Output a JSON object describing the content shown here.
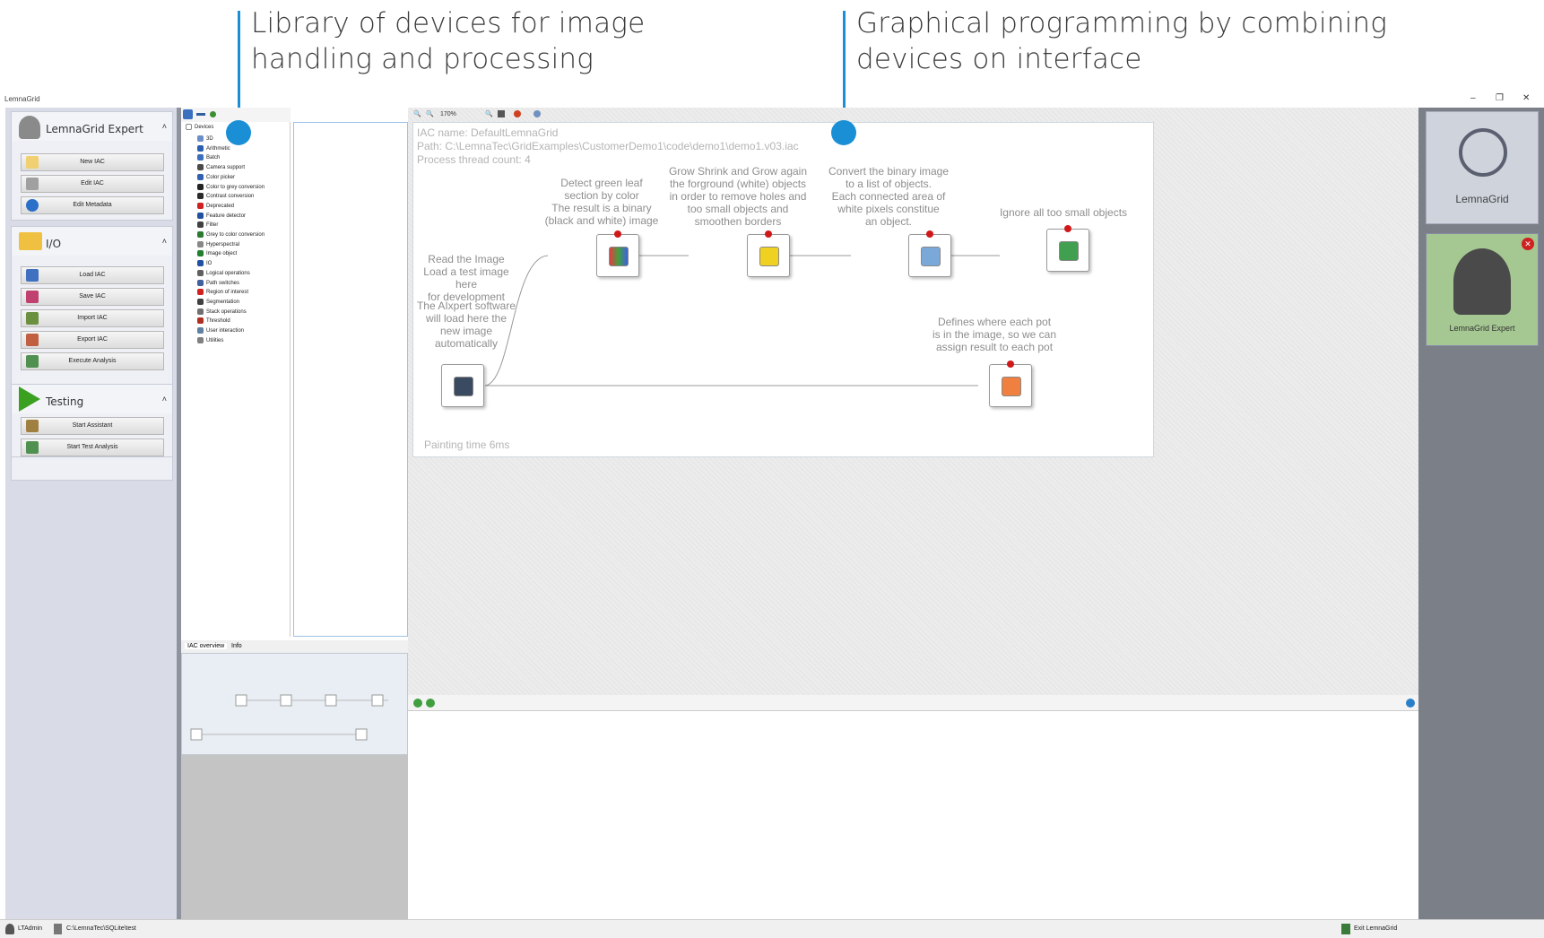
{
  "callouts": {
    "library_line1": "Library of devices for image",
    "library_line2": "handling and processing",
    "graphical_line1": "Graphical programming by combining",
    "graphical_line2": "devices on interface"
  },
  "window": {
    "title": "LemnaGrid",
    "minimize": "–",
    "restore": "❐",
    "close": "✕"
  },
  "left_panel": {
    "expert_group": {
      "title": "LemnaGrid Expert",
      "buttons": [
        "New IAC",
        "Edit IAC",
        "Edit Metadata"
      ]
    },
    "io_group": {
      "title": "I/O",
      "buttons": [
        "Load IAC",
        "Save IAC",
        "Import IAC",
        "Export IAC",
        "Execute Analysis"
      ]
    },
    "testing_group": {
      "title": "Testing",
      "buttons": [
        "Start Assistant",
        "Start Test Analysis"
      ]
    }
  },
  "tree": {
    "root": "Devices",
    "items": [
      "3D",
      "Arithmetic",
      "Batch",
      "Camera support",
      "Color picker",
      "Color to grey conversion",
      "Contrast conversion",
      "Deprecated",
      "Feature detector",
      "Filter",
      "Grey to color conversion",
      "Hyperspectral",
      "Image object",
      "IO",
      "Logical operations",
      "Path switches",
      "Region of interest",
      "Segmentation",
      "Stack operations",
      "Threshold",
      "User interaction",
      "Utilities"
    ],
    "item_colors": [
      "#6a8fc8",
      "#2a5fb0",
      "#3a6fc0",
      "#4a4a4a",
      "#3060b0",
      "#222222",
      "#2a2a2a",
      "#d02020",
      "#2050a0",
      "#404040",
      "#2a7a30",
      "#888888",
      "#208030",
      "#2050a0",
      "#606060",
      "#4060a0",
      "#d02020",
      "#404040",
      "#707070",
      "#b03020",
      "#6080a0",
      "#808080"
    ]
  },
  "overview_tabs": [
    "IAC overview",
    "Info"
  ],
  "canvas_toolbar": {
    "zoom": "170%"
  },
  "canvas": {
    "iac_name": "IAC name: DefaultLemnaGrid",
    "path": "Path: C:\\LemnaTec\\GridExamples\\CustomerDemo1\\code\\demo1\\demo1.v03.iac",
    "thread_count": "Process thread count: 4",
    "painting_time": "Painting time 6ms",
    "notes": {
      "read_image": [
        "Read the Image",
        "Load a test image here",
        "for development"
      ],
      "aixpert": [
        "The AIxpert software",
        "will load here the",
        "new image",
        "automatically"
      ],
      "detect_green": [
        "Detect green leaf",
        "section by color",
        "The result is a binary",
        "(black and white) image"
      ],
      "grow_shrink": [
        "Grow Shrink and Grow again",
        "the forground (white) objects",
        "in order to remove holes and",
        "too small objects and",
        "smoothen borders"
      ],
      "convert": [
        "Convert the binary image",
        "to a list of objects.",
        "Each connected area of",
        "white pixels constitue",
        "an object."
      ],
      "ignore": [
        "Ignore all too small objects"
      ],
      "defines": [
        "Defines where each pot",
        "is in the image, so we can",
        "assign result to each pot"
      ]
    }
  },
  "right_panel": {
    "logo_label": "LemnaGrid",
    "expert_label": "LemnaGrid Expert"
  },
  "statusbar": {
    "user": "LTAdmin",
    "db": "C:\\LemnaTec\\SQLite\\test",
    "exit": "Exit LemnaGrid"
  },
  "colors": {
    "accent": "#1a8fd6",
    "pin": "#d01818",
    "left_bg": "#d9dce6",
    "right_bg": "#7b7f88",
    "expert_tile": "#a5c792"
  }
}
